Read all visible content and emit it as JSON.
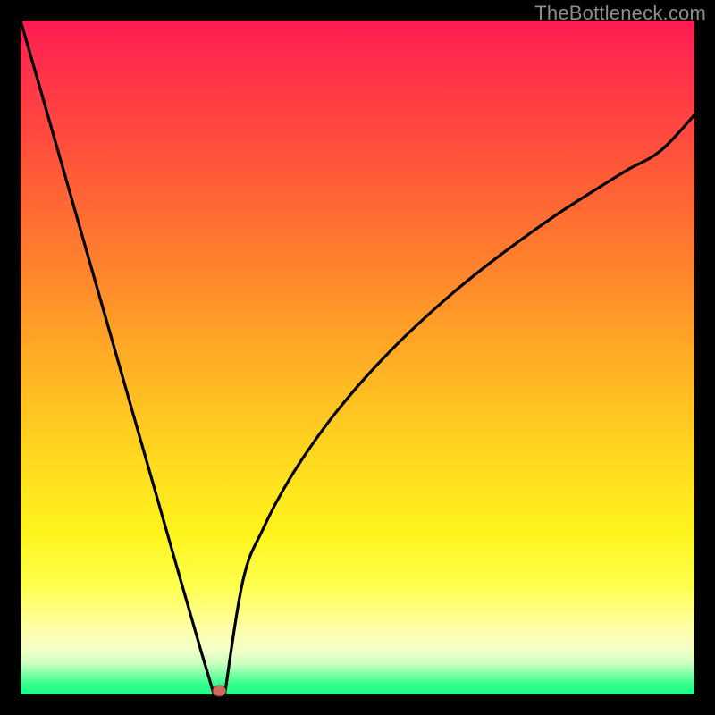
{
  "watermark": "TheBottleneck.com",
  "colors": {
    "frame": "#000000",
    "curve": "#000000",
    "marker_fill": "#d06a5c",
    "marker_stroke": "#7a3b30",
    "gradient_stops": [
      "#ff1a53",
      "#ff2e4c",
      "#ff4a3e",
      "#ff6a33",
      "#ff8a2b",
      "#ffa726",
      "#ffc522",
      "#ffe01f",
      "#fff41c",
      "#feff4e",
      "#fdffa5",
      "#f4ffc8",
      "#c8ffbf",
      "#7dffa3",
      "#33ff8e",
      "#1aff86"
    ]
  },
  "chart_data": {
    "type": "line",
    "title": "",
    "xlabel": "",
    "ylabel": "",
    "xlim": [
      0,
      100
    ],
    "ylim": [
      0,
      100
    ],
    "grid": false,
    "legend": false,
    "curve_note": "V-shaped curve: steep near-linear descent from upper-left to minimum near x≈29.5, then concave-increasing sqrt-like rise toward right edge at y≈86.",
    "left_branch": {
      "x": [
        0.0,
        3.0,
        6.0,
        9.0,
        12.0,
        15.0,
        18.0,
        21.0,
        24.0,
        27.0,
        28.7
      ],
      "y": [
        100.0,
        89.6,
        79.1,
        68.6,
        58.1,
        47.6,
        37.1,
        26.6,
        16.1,
        5.7,
        0.0
      ]
    },
    "flat": {
      "x": [
        28.7,
        30.3
      ],
      "y": [
        0.0,
        0.0
      ]
    },
    "right_branch": {
      "x": [
        30.3,
        33,
        36,
        40,
        45,
        50,
        55,
        60,
        65,
        70,
        75,
        80,
        85,
        90,
        95,
        100
      ],
      "y": [
        0.0,
        16.9,
        24.6,
        32.1,
        39.5,
        45.7,
        51.1,
        55.9,
        60.3,
        64.3,
        68.0,
        71.5,
        74.7,
        77.8,
        80.7,
        86.0
      ]
    },
    "marker": {
      "x": 29.5,
      "y": 0.0
    }
  }
}
